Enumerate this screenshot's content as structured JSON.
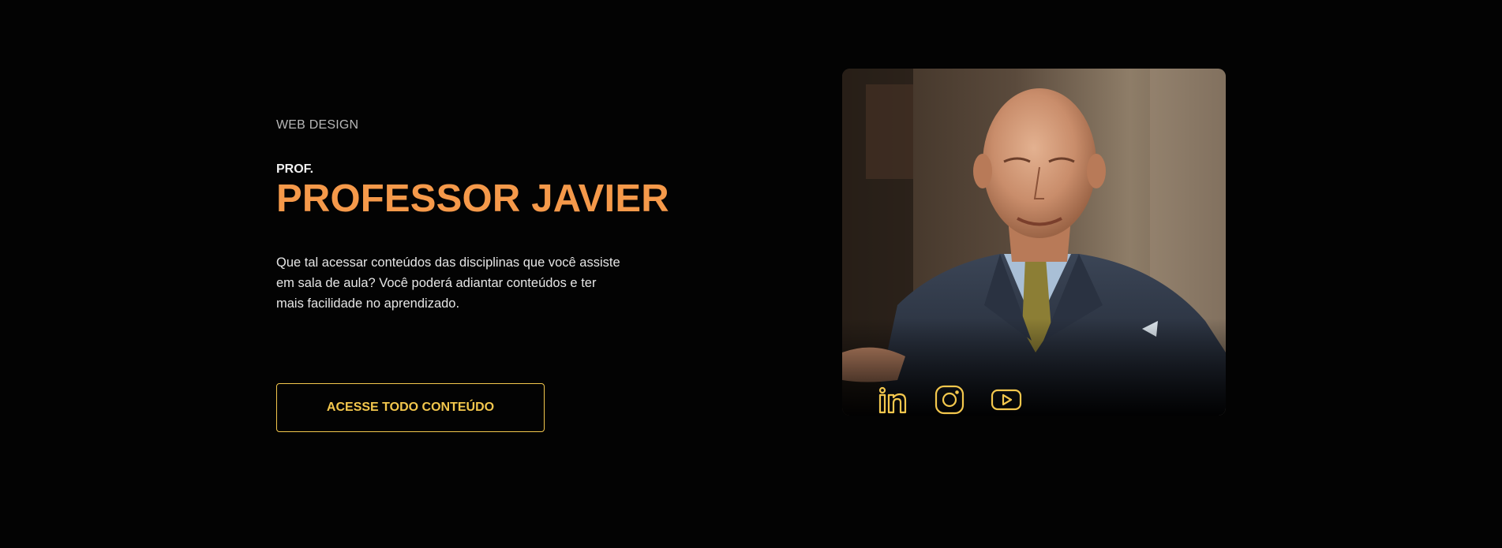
{
  "hero": {
    "category": "WEB DESIGN",
    "prefix": "PROF.",
    "name": "PROFESSOR JAVIER",
    "description": "Que tal acessar conteúdos das disciplinas que você assiste em sala de aula? Você poderá adiantar conteúdos e ter mais facilidade no aprendizado.",
    "cta_label": "ACESSE TODO CONTEÚDO"
  },
  "card": {
    "photo_alt": "Professor Javier",
    "socials": [
      {
        "icon": "linkedin-icon"
      },
      {
        "icon": "instagram-icon"
      },
      {
        "icon": "youtube-icon"
      }
    ]
  },
  "colors": {
    "background": "#030303",
    "accent_orange": "#f5994a",
    "accent_yellow": "#f3c74d"
  }
}
